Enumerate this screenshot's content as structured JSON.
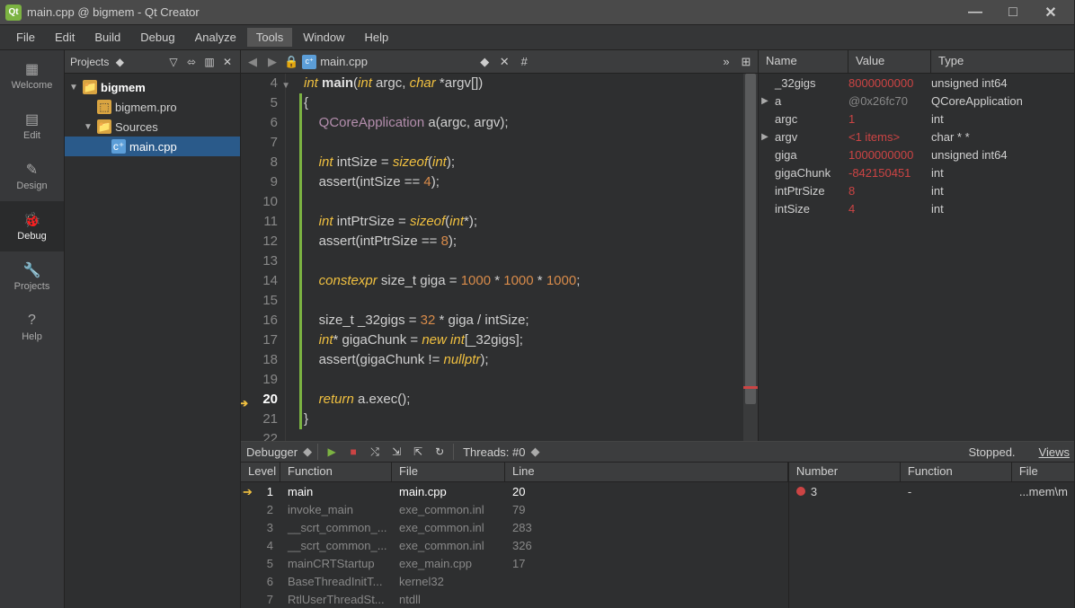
{
  "window": {
    "title": "main.cpp @ bigmem - Qt Creator",
    "app_icon_text": "Qt"
  },
  "menu": {
    "file": "File",
    "edit": "Edit",
    "build": "Build",
    "debug": "Debug",
    "analyze": "Analyze",
    "tools": "Tools",
    "window": "Window",
    "help": "Help"
  },
  "sidebar": {
    "welcome": "Welcome",
    "edit": "Edit",
    "design": "Design",
    "debug": "Debug",
    "projects": "Projects",
    "help": "Help"
  },
  "projects": {
    "selector": "Projects",
    "tree": {
      "root": "bigmem",
      "pro": "bigmem.pro",
      "sources": "Sources",
      "main": "main.cpp"
    }
  },
  "editor": {
    "filename": "main.cpp",
    "hash": "#",
    "lines": [
      {
        "n": 4,
        "tokens": [
          [
            "kw",
            "int "
          ],
          [
            "fn",
            "main"
          ],
          [
            "op",
            "("
          ],
          [
            "kw",
            "int "
          ],
          [
            "op",
            "argc, "
          ],
          [
            "kw",
            "char "
          ],
          [
            "op",
            "*argv[])"
          ]
        ],
        "fold": true
      },
      {
        "n": 5,
        "tokens": [
          [
            "op",
            "{"
          ]
        ],
        "mod": true
      },
      {
        "n": 6,
        "tokens": [
          [
            "op",
            "    "
          ],
          [
            "cls",
            "QCoreApplication"
          ],
          [
            "op",
            " a(argc, argv);"
          ]
        ],
        "mod": true
      },
      {
        "n": 7,
        "tokens": [],
        "mod": true
      },
      {
        "n": 8,
        "tokens": [
          [
            "op",
            "    "
          ],
          [
            "kw",
            "int "
          ],
          [
            "op",
            "intSize = "
          ],
          [
            "sizeof",
            "sizeof"
          ],
          [
            "op",
            "("
          ],
          [
            "kw",
            "int"
          ],
          [
            "op",
            ");"
          ]
        ],
        "mod": true
      },
      {
        "n": 9,
        "tokens": [
          [
            "op",
            "    assert(intSize == "
          ],
          [
            "num",
            "4"
          ],
          [
            "op",
            ");"
          ]
        ],
        "mod": true
      },
      {
        "n": 10,
        "tokens": [],
        "mod": true
      },
      {
        "n": 11,
        "tokens": [
          [
            "op",
            "    "
          ],
          [
            "kw",
            "int "
          ],
          [
            "op",
            "intPtrSize = "
          ],
          [
            "sizeof",
            "sizeof"
          ],
          [
            "op",
            "("
          ],
          [
            "kw",
            "int"
          ],
          [
            "op",
            "*);"
          ]
        ],
        "mod": true
      },
      {
        "n": 12,
        "tokens": [
          [
            "op",
            "    assert(intPtrSize == "
          ],
          [
            "num",
            "8"
          ],
          [
            "op",
            ");"
          ]
        ],
        "mod": true
      },
      {
        "n": 13,
        "tokens": [],
        "mod": true
      },
      {
        "n": 14,
        "tokens": [
          [
            "op",
            "    "
          ],
          [
            "kw",
            "constexpr "
          ],
          [
            "op",
            "size_t giga = "
          ],
          [
            "num",
            "1000"
          ],
          [
            "op",
            " * "
          ],
          [
            "num",
            "1000"
          ],
          [
            "op",
            " * "
          ],
          [
            "num",
            "1000"
          ],
          [
            "op",
            ";"
          ]
        ],
        "mod": true
      },
      {
        "n": 15,
        "tokens": [],
        "mod": true
      },
      {
        "n": 16,
        "tokens": [
          [
            "op",
            "    size_t _32gigs = "
          ],
          [
            "num",
            "32"
          ],
          [
            "op",
            " * giga / intSize;"
          ]
        ],
        "mod": true
      },
      {
        "n": 17,
        "tokens": [
          [
            "op",
            "    "
          ],
          [
            "kw",
            "int"
          ],
          [
            "op",
            "* gigaChunk = "
          ],
          [
            "kw",
            "new "
          ],
          [
            "kw",
            "int"
          ],
          [
            "op",
            "[_32gigs];"
          ]
        ],
        "mod": true
      },
      {
        "n": 18,
        "tokens": [
          [
            "op",
            "    assert(gigaChunk != "
          ],
          [
            "nullkw",
            "nullptr"
          ],
          [
            "op",
            ");"
          ]
        ],
        "mod": true
      },
      {
        "n": 19,
        "tokens": [],
        "mod": true
      },
      {
        "n": 20,
        "tokens": [
          [
            "op",
            "    "
          ],
          [
            "kw",
            "return "
          ],
          [
            "op",
            "a.exec();"
          ]
        ],
        "current": true,
        "mod": true
      },
      {
        "n": 21,
        "tokens": [
          [
            "op",
            "}"
          ]
        ],
        "mod": true
      },
      {
        "n": 22,
        "tokens": []
      }
    ]
  },
  "locals": {
    "headers": {
      "name": "Name",
      "value": "Value",
      "type": "Type"
    },
    "rows": [
      {
        "exp": "",
        "name": "_32gigs",
        "value": "8000000000",
        "type": "unsigned int64"
      },
      {
        "exp": "▶",
        "name": "a",
        "value": "@0x26fc70",
        "dim": true,
        "type": "QCoreApplication"
      },
      {
        "exp": "",
        "name": "argc",
        "value": "1",
        "type": "int"
      },
      {
        "exp": "▶",
        "name": "argv",
        "value": "<1 items>",
        "type": "char * *"
      },
      {
        "exp": "",
        "name": "giga",
        "value": "1000000000",
        "type": "unsigned int64"
      },
      {
        "exp": "",
        "name": "gigaChunk",
        "value": "-842150451",
        "type": "int"
      },
      {
        "exp": "",
        "name": "intPtrSize",
        "value": "8",
        "type": "int"
      },
      {
        "exp": "",
        "name": "intSize",
        "value": "4",
        "type": "int"
      }
    ]
  },
  "debugger": {
    "label": "Debugger",
    "threads": "Threads: #0",
    "status": "Stopped.",
    "views": "Views",
    "stack": {
      "headers": {
        "level": "Level",
        "function": "Function",
        "file": "File",
        "line": "Line"
      },
      "rows": [
        {
          "level": "1",
          "function": "main",
          "file": "main.cpp",
          "line": "20",
          "active": true
        },
        {
          "level": "2",
          "function": "invoke_main",
          "file": "exe_common.inl",
          "line": "79"
        },
        {
          "level": "3",
          "function": "__scrt_common_...",
          "file": "exe_common.inl",
          "line": "283"
        },
        {
          "level": "4",
          "function": "__scrt_common_...",
          "file": "exe_common.inl",
          "line": "326"
        },
        {
          "level": "5",
          "function": "mainCRTStartup",
          "file": "exe_main.cpp",
          "line": "17"
        },
        {
          "level": "6",
          "function": "BaseThreadInitT...",
          "file": "kernel32",
          "line": ""
        },
        {
          "level": "7",
          "function": "RtlUserThreadSt...",
          "file": "ntdll",
          "line": ""
        }
      ]
    },
    "breakpoints": {
      "headers": {
        "number": "Number",
        "function": "Function",
        "file": "File"
      },
      "rows": [
        {
          "number": "3",
          "function": "-",
          "file": "...mem\\m"
        }
      ]
    }
  }
}
